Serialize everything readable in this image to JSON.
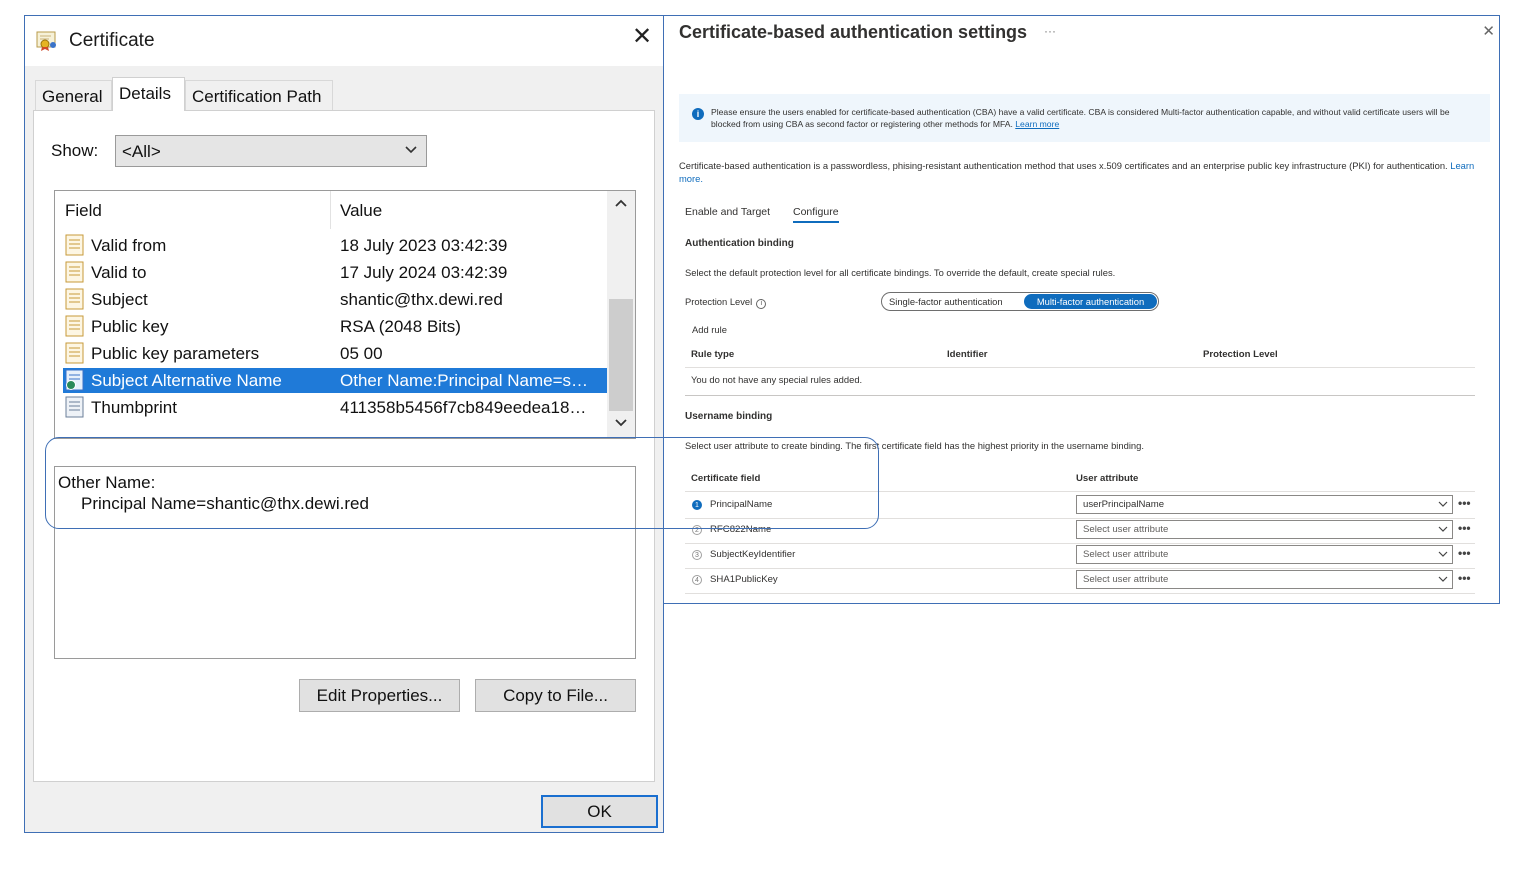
{
  "certificate_dialog": {
    "title": "Certificate",
    "close_glyph": "✕",
    "tabs": [
      "General",
      "Details",
      "Certification Path"
    ],
    "active_tab": "Details",
    "show_label": "Show:",
    "show_value": "<All>",
    "columns": {
      "field": "Field",
      "value": "Value"
    },
    "rows": [
      {
        "field": "Valid from",
        "value": "18 July 2023 03:42:39",
        "icon": "certificate-field-icon"
      },
      {
        "field": "Valid to",
        "value": "17 July 2024 03:42:39",
        "icon": "certificate-field-icon"
      },
      {
        "field": "Subject",
        "value": "shantic@thx.dewi.red",
        "icon": "certificate-field-icon"
      },
      {
        "field": "Public key",
        "value": "RSA (2048 Bits)",
        "icon": "certificate-field-icon"
      },
      {
        "field": "Public key parameters",
        "value": "05 00",
        "icon": "certificate-field-icon"
      },
      {
        "field": "Subject Alternative Name",
        "value": "Other Name:Principal Name=s…",
        "icon": "extension-field-icon",
        "selected": true
      },
      {
        "field": "Thumbprint",
        "value": "411358b5456f7cb849eedea18…",
        "icon": "thumbprint-field-icon"
      }
    ],
    "detail": {
      "line1": "Other Name:",
      "line2": "Principal Name=shantic@thx.dewi.red"
    },
    "buttons": {
      "edit_properties": "Edit Properties...",
      "copy_to_file": "Copy to File...",
      "ok": "OK"
    }
  },
  "azure_panel": {
    "title": "Certificate-based authentication settings",
    "more_glyph": "···",
    "close_glyph": "✕",
    "info_banner": {
      "text": "Please ensure the users enabled for certificate-based authentication (CBA) have a valid certificate. CBA is considered Multi-factor authentication capable, and without valid certificate users will be blocked from using CBA as second factor or registering other methods for MFA.",
      "link": "Learn more"
    },
    "description": {
      "text": "Certificate-based authentication is a passwordless, phising-resistant authentication method that uses x.509 certificates and an enterprise public key infrastructure (PKI) for authentication.",
      "link": "Learn more."
    },
    "tabs": [
      "Enable and Target",
      "Configure"
    ],
    "active_tab": "Configure",
    "auth_binding": {
      "heading": "Authentication binding",
      "description": "Select the default protection level for all certificate bindings. To override the default, create special rules.",
      "protection_label": "Protection Level",
      "toggle_options": [
        "Single-factor authentication",
        "Multi-factor authentication"
      ],
      "selected_option": "Multi-factor authentication",
      "add_rule": "Add rule",
      "columns": [
        "Rule type",
        "Identifier",
        "Protection Level"
      ],
      "empty_text": "You do not have any special rules added."
    },
    "username_binding": {
      "heading": "Username binding",
      "description": "Select user attribute to create binding. The first certificate field has the highest priority in the username binding.",
      "columns": [
        "Certificate field",
        "User attribute"
      ],
      "rows": [
        {
          "num": "1",
          "field": "PrincipalName",
          "attribute": "userPrincipalName",
          "active": true
        },
        {
          "num": "2",
          "field": "RFC822Name",
          "attribute": "Select user attribute",
          "active": false
        },
        {
          "num": "3",
          "field": "SubjectKeyIdentifier",
          "attribute": "Select user attribute",
          "active": false
        },
        {
          "num": "4",
          "field": "SHA1PublicKey",
          "attribute": "Select user attribute",
          "active": false
        }
      ]
    }
  },
  "colors": {
    "azure_accent": "#0f6cbd",
    "selection_blue": "#1f7ad8",
    "highlight_border": "#3f6fb5"
  }
}
